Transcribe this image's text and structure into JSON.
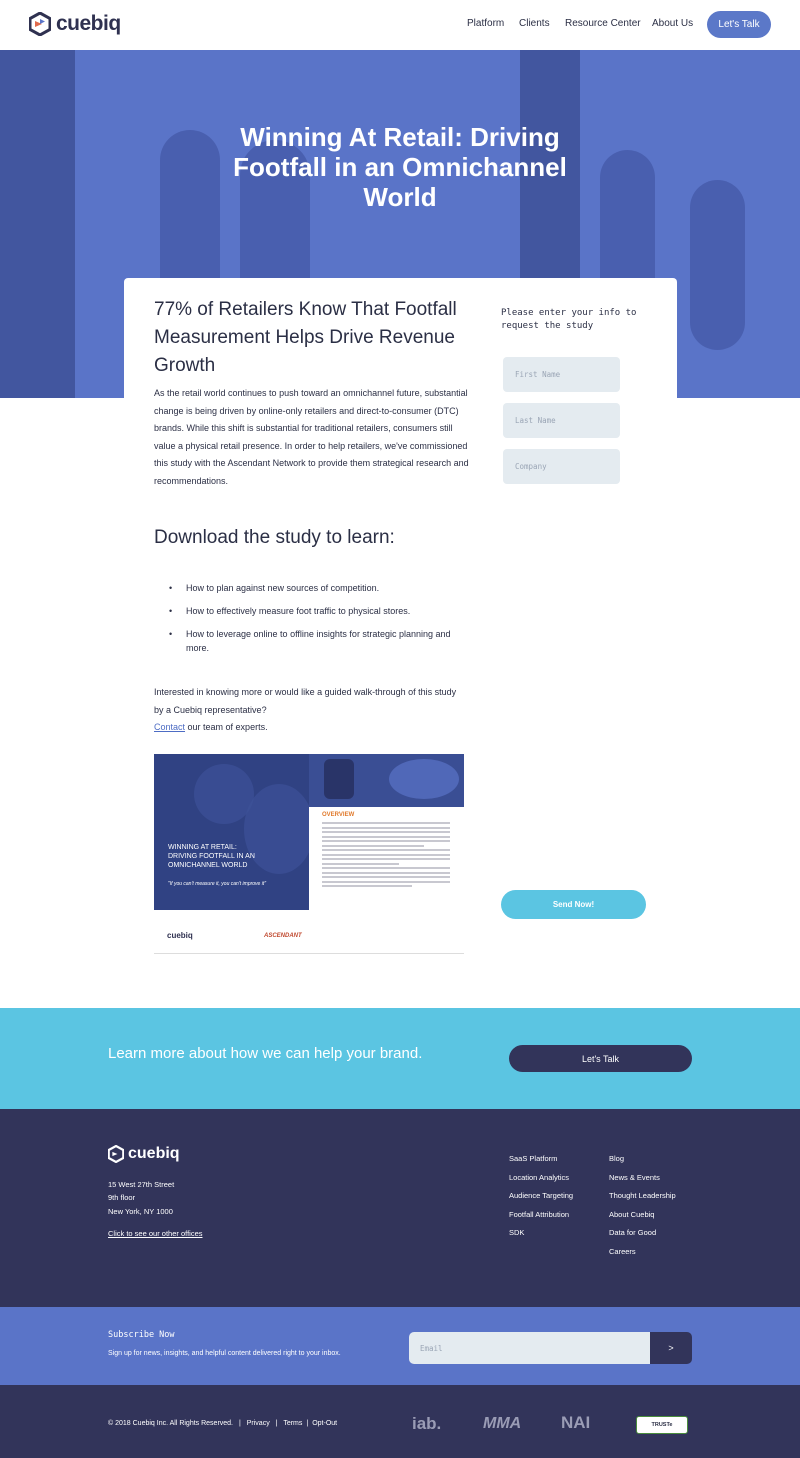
{
  "header": {
    "logo_text": "cuebiq",
    "nav": [
      "Platform",
      "Clients",
      "Resource Center",
      "About Us"
    ],
    "cta_label": "Let's Talk"
  },
  "hero": {
    "title": "Winning At Retail: Driving Footfall in an Omnichannel World"
  },
  "content": {
    "heading": "77% of Retailers Know That Footfall Measurement Helps Drive Revenue Growth",
    "paragraph": "As the retail world continues to push toward an omnichannel future, substantial change is being driven by online-only retailers and direct-to-consumer (DTC) brands. While this shift is substantial for traditional retailers, consumers still value a physical retail presence. In order to help retailers, we've commissioned this study with the Ascendant Network to provide them strategical research and recommendations.",
    "download_heading": "Download the study to learn:",
    "bullets": [
      "How to plan against new sources of competition.",
      "How to effectively measure foot traffic to physical stores.",
      "How to leverage online to offline insights for strategic planning and more."
    ],
    "interest_text": "Interested in knowing more or would like a guided walk-through of this study by a Cuebiq representative?",
    "contact_link": "Contact",
    "contact_suffix": " our team of experts."
  },
  "study_preview": {
    "title_line1": "WINNING AT RETAIL:",
    "title_line2": "DRIVING FOOTFALL IN AN",
    "title_line3": "OMNICHANNEL WORLD",
    "quote": "\"If you can't measure it, you can't improve it\"",
    "overview": "OVERVIEW",
    "logo_left": "cuebiq",
    "logo_right": "ASCENDANT"
  },
  "form": {
    "label": "Please enter your info to request the study",
    "first_name_placeholder": "First Name",
    "last_name_placeholder": "Last Name",
    "company_placeholder": "Company",
    "submit_label": "Send Now!"
  },
  "cta_band": {
    "text": "Learn more about how we can help your brand.",
    "button": "Let's Talk"
  },
  "footer": {
    "logo_text": "cuebiq",
    "address": [
      "15 West 27th Street",
      "9th floor",
      "New York, NY 1000"
    ],
    "offices_link": "Click to see our other offices",
    "col1": [
      "SaaS Platform",
      "Location Analytics",
      "Audience Targeting",
      "Footfall Attribution",
      "SDK"
    ],
    "col2": [
      "Blog",
      "News & Events",
      "Thought Leadership",
      "About Cuebiq",
      "Data for Good",
      "Careers"
    ]
  },
  "subscribe": {
    "title": "Subscribe Now",
    "desc": "Sign up for news, insights, and helpful content delivered right to your inbox.",
    "email_placeholder": "Email",
    "submit": ">"
  },
  "bottom": {
    "copyright": "© 2018 Cuebiq Inc. All Rights Reserved.",
    "privacy": "Privacy",
    "terms": "Terms",
    "optout": "Opt-Out",
    "badges": [
      "iab.",
      "MMA",
      "NAI",
      "TRUSTe"
    ]
  },
  "colors": {
    "brand_dark": "#32345a",
    "brand_blue": "#5a74c8",
    "accent_cyan": "#5bc5e2"
  }
}
